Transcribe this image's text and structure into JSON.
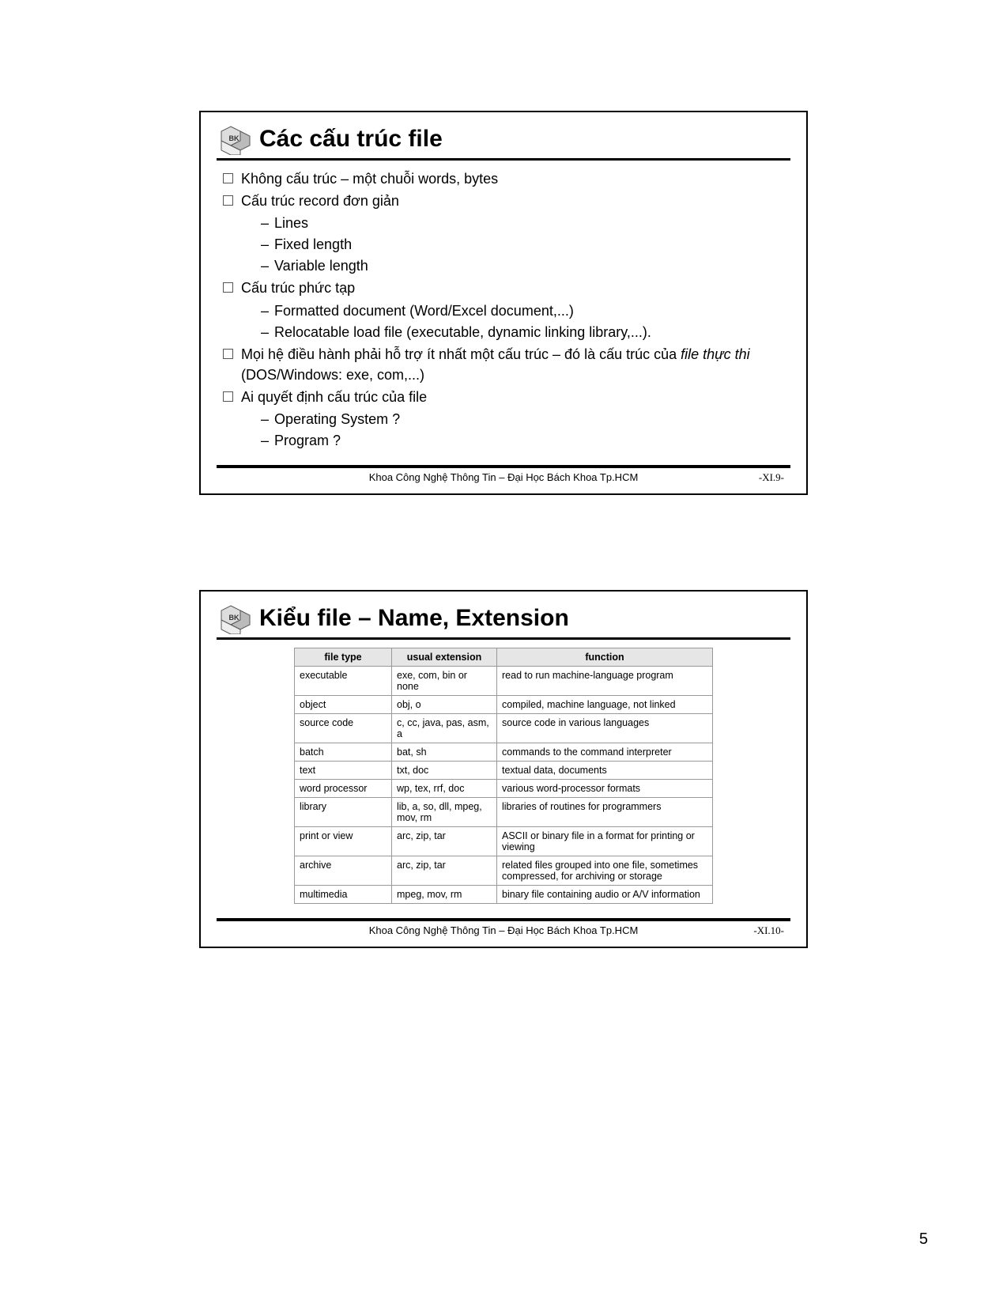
{
  "page_number": "5",
  "slide1": {
    "title": "Các cấu trúc file",
    "bullets": [
      {
        "text": "Không cấu trúc – một chuỗi words, bytes",
        "subs": []
      },
      {
        "text": "Cấu trúc record đơn giản",
        "subs": [
          "Lines",
          "Fixed length",
          "Variable length"
        ]
      },
      {
        "text": "Cấu trúc phức tạp",
        "subs": [
          "Formatted document  (Word/Excel document,...)",
          "Relocatable load file (executable, dynamic linking library,...)."
        ]
      },
      {
        "text_pre": "Mọi hệ điều hành phải hỗ trợ ít nhất một cấu trúc –  đó là cấu trúc của ",
        "text_italic": "file thực thi",
        "text_post": " (DOS/Windows: exe, com,...)",
        "subs": []
      },
      {
        "text": "Ai quyết định cấu trúc của file",
        "subs": [
          "Operating System ?",
          "Program ?"
        ]
      }
    ],
    "footer_center": "Khoa Công Nghệ Thông Tin – Đại Học Bách Khoa Tp.HCM",
    "footer_right": "-XI.9-"
  },
  "slide2": {
    "title": "Kiểu file – Name, Extension",
    "table": {
      "headers": [
        "file type",
        "usual extension",
        "function"
      ],
      "rows": [
        [
          "executable",
          "exe, com, bin or none",
          "read to run machine-language program"
        ],
        [
          "object",
          "obj, o",
          "compiled, machine language, not linked"
        ],
        [
          "source code",
          "c, cc, java, pas, asm, a",
          "source code in various languages"
        ],
        [
          "batch",
          "bat, sh",
          "commands to the command interpreter"
        ],
        [
          "text",
          "txt, doc",
          "textual data, documents"
        ],
        [
          "word processor",
          "wp, tex, rrf, doc",
          "various word-processor formats"
        ],
        [
          "library",
          "lib, a, so, dll, mpeg, mov, rm",
          "libraries of routines for programmers"
        ],
        [
          "print or view",
          "arc, zip, tar",
          "ASCII or binary file in a format for printing or viewing"
        ],
        [
          "archive",
          "arc, zip, tar",
          "related files grouped into one file, sometimes compressed, for archiving or storage"
        ],
        [
          "multimedia",
          "mpeg, mov, rm",
          "binary file containing audio or A/V information"
        ]
      ]
    },
    "footer_center": "Khoa Công Nghệ Thông Tin – Đại Học Bách Khoa Tp.HCM",
    "footer_right": "-XI.10-"
  }
}
